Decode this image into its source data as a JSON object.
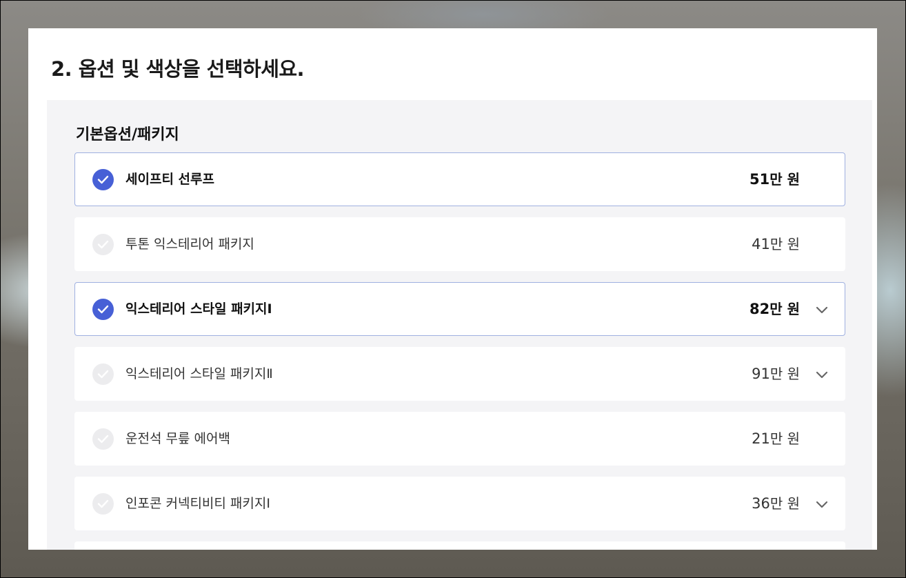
{
  "page_title": "2. 옵션 및 색상을 선택하세요.",
  "section_title": "기본옵션/패키지",
  "colors": {
    "accent": "#4760d6",
    "selected_border": "#9fb0e0",
    "unchecked": "#ececee",
    "panel_bg": "#f4f4f6"
  },
  "options": [
    {
      "name": "세이프티 선루프",
      "price_num": "51",
      "price_unit": "만 원",
      "selected": true,
      "expandable": false
    },
    {
      "name": "투톤 익스테리어 패키지",
      "price_num": "41",
      "price_unit": "만 원",
      "selected": false,
      "expandable": false
    },
    {
      "name": "익스테리어 스타일 패키지Ⅰ",
      "price_num": "82",
      "price_unit": "만 원",
      "selected": true,
      "expandable": true
    },
    {
      "name": "익스테리어 스타일 패키지Ⅱ",
      "price_num": "91",
      "price_unit": "만 원",
      "selected": false,
      "expandable": true
    },
    {
      "name": "운전석 무릎 에어백",
      "price_num": "21",
      "price_unit": "만 원",
      "selected": false,
      "expandable": false
    },
    {
      "name": "인포콘 커넥티비티 패키지Ⅰ",
      "price_num": "36",
      "price_unit": "만 원",
      "selected": false,
      "expandable": true
    }
  ],
  "icons": {
    "check": "check-icon",
    "expand": "chevron-down-icon"
  }
}
